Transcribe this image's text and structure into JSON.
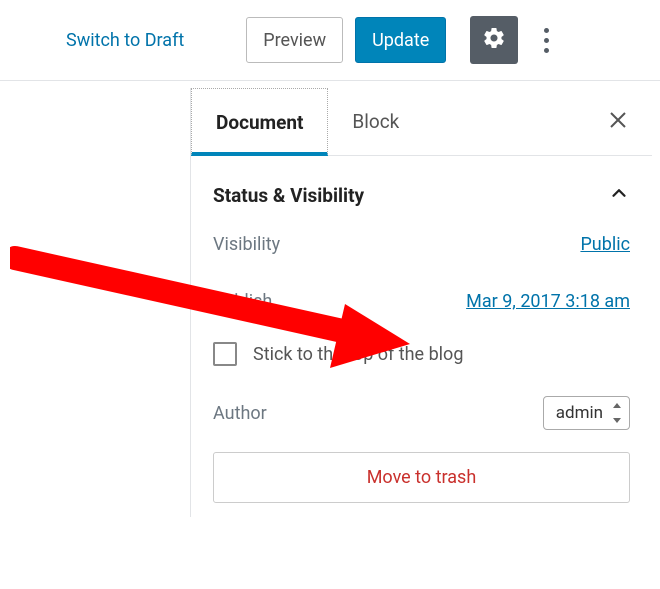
{
  "toolbar": {
    "switch_to_draft": "Switch to Draft",
    "preview": "Preview",
    "update": "Update"
  },
  "tabs": {
    "document": "Document",
    "block": "Block"
  },
  "status_panel": {
    "title": "Status & Visibility",
    "visibility_label": "Visibility",
    "visibility_value": "Public",
    "publish_label": "Publish",
    "publish_value": "Mar 9, 2017 3:18 am",
    "sticky_label": "Stick to the top of the blog",
    "author_label": "Author",
    "author_value": "admin",
    "trash_label": "Move to trash"
  }
}
